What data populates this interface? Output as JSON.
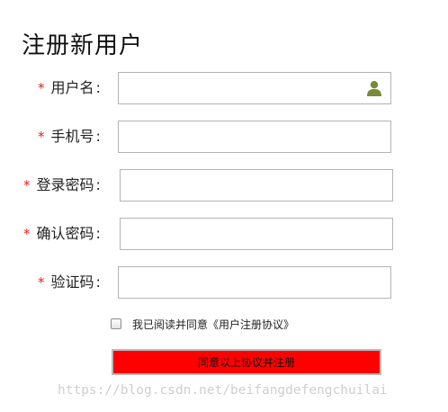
{
  "page": {
    "title": "注册新用户"
  },
  "form": {
    "required_mark": "*",
    "colon": ":",
    "fields": [
      {
        "label": "用户名",
        "value": "",
        "icon": "user-icon"
      },
      {
        "label": "手机号",
        "value": ""
      },
      {
        "label": "登录密码",
        "value": ""
      },
      {
        "label": "确认密码",
        "value": ""
      },
      {
        "label": "验证码",
        "value": ""
      }
    ],
    "agreement": {
      "checked": false,
      "text": "我已阅读并同意《用户注册协议》"
    },
    "submit_label": "同意以上协议并注册"
  },
  "watermark": "https://blog.csdn.net/beifangdefengchuilai",
  "colors": {
    "required": "#e0231c",
    "submit_bg": "#ff0000",
    "field_border": "#b4b4b4",
    "user_icon": "#7b8a3a"
  }
}
